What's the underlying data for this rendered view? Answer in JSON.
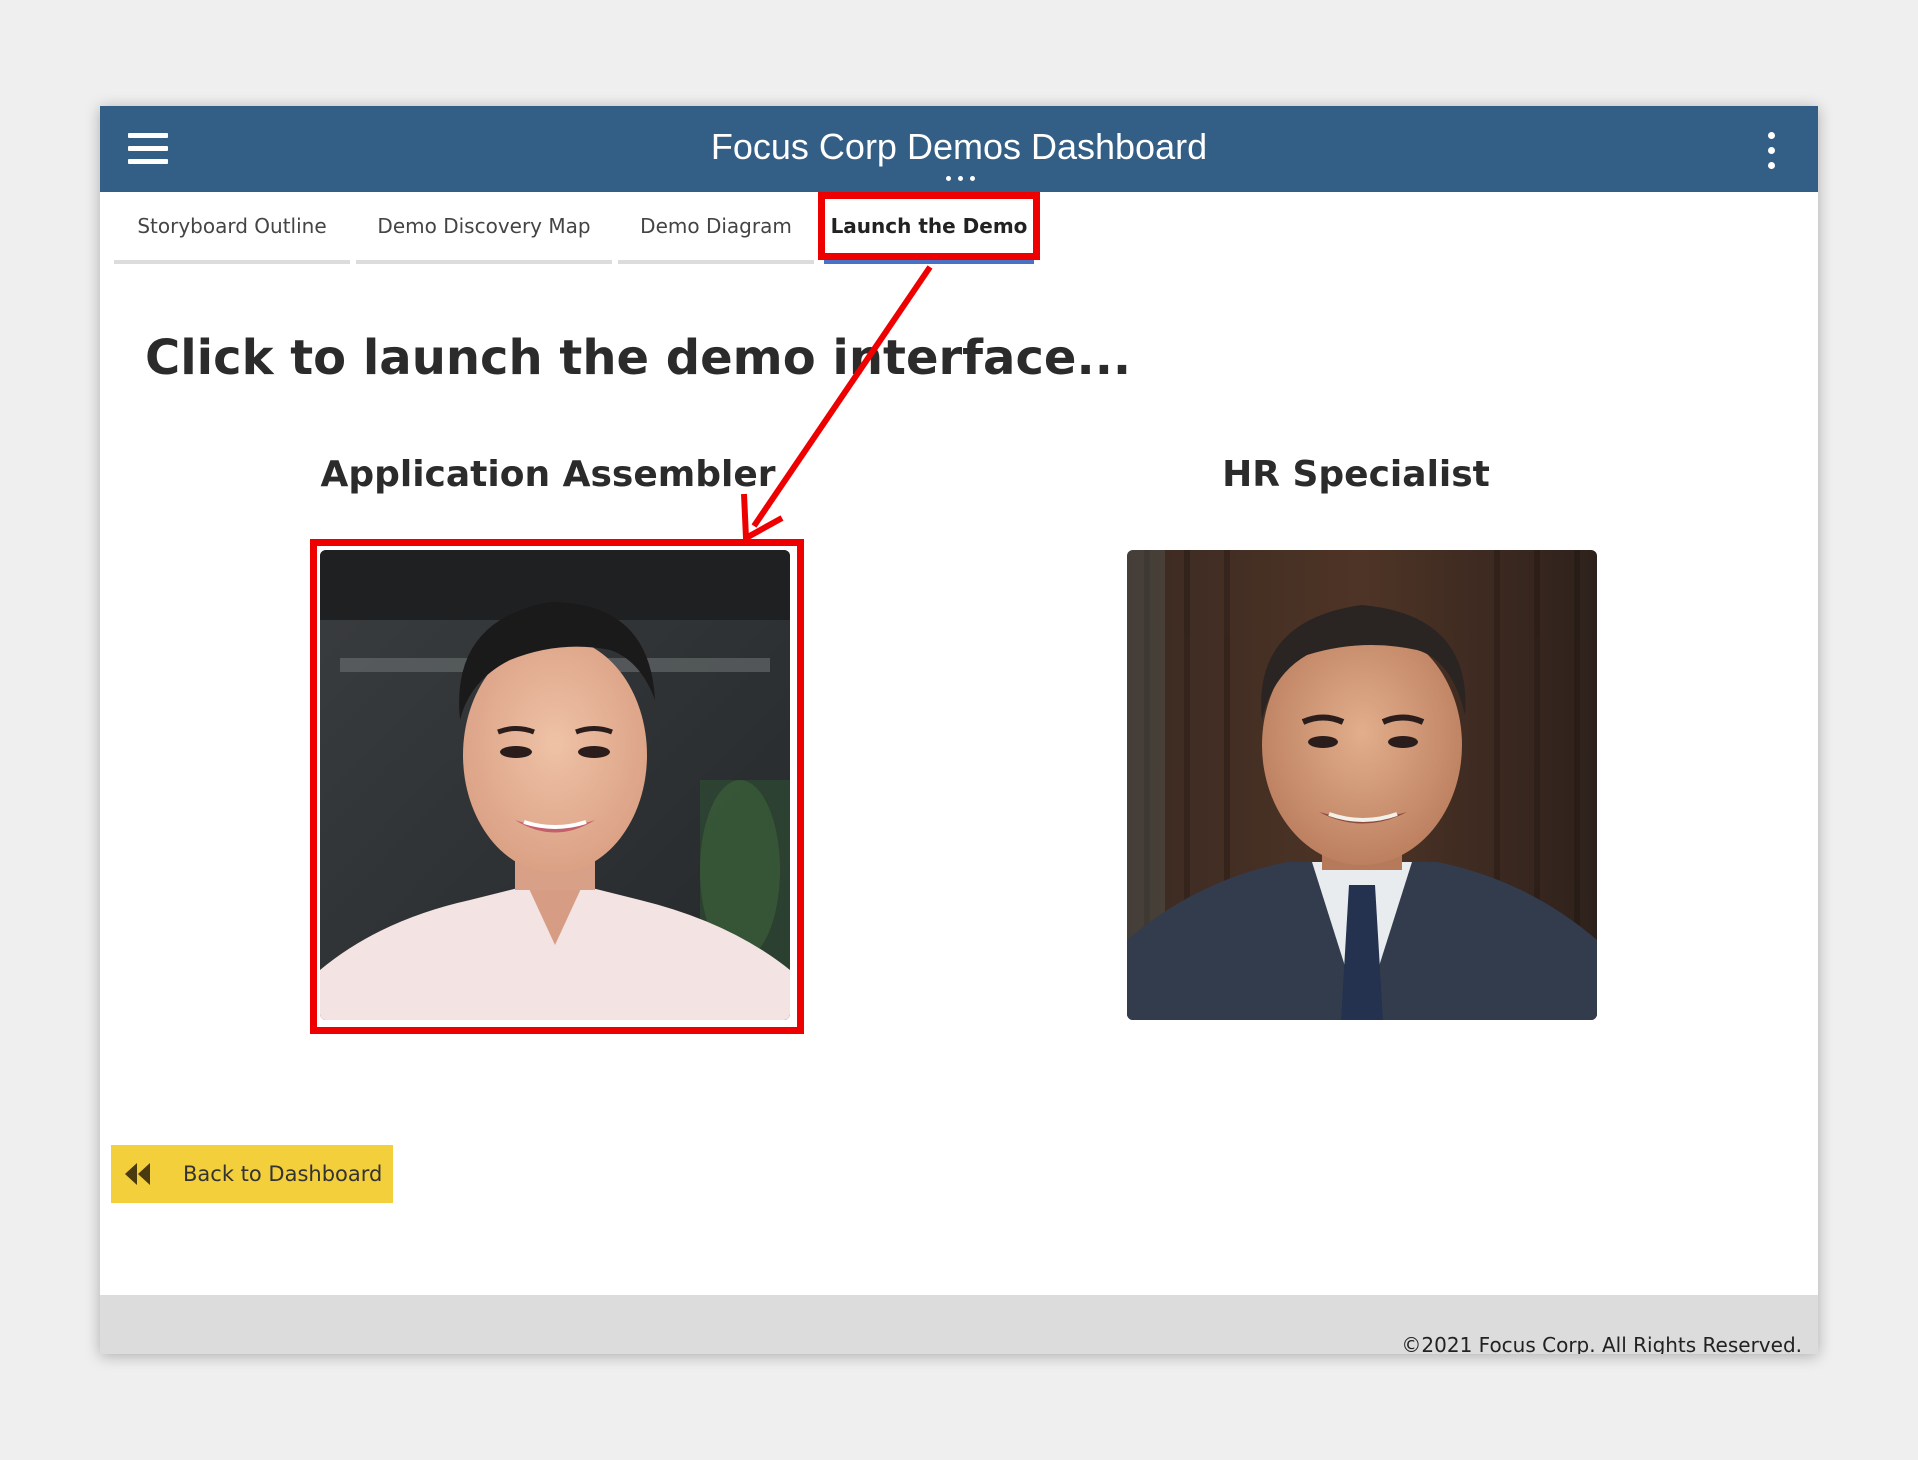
{
  "header": {
    "title": "Focus Corp Demos Dashboard",
    "menu_icon": "hamburger-menu-icon",
    "more_icon": "kebab-menu-icon"
  },
  "tabs": [
    {
      "label": "Storyboard Outline",
      "active": false
    },
    {
      "label": "Demo Discovery Map",
      "active": false
    },
    {
      "label": "Demo Diagram",
      "active": false
    },
    {
      "label": "Launch the Demo",
      "active": true
    }
  ],
  "main": {
    "heading": "Click to launch the demo interface...",
    "personas": [
      {
        "title": "Application Assembler",
        "image": "woman-portrait-photo"
      },
      {
        "title": "HR Specialist",
        "image": "man-portrait-photo"
      }
    ]
  },
  "back_button": {
    "label": "Back to Dashboard",
    "icon": "double-chevron-left-icon"
  },
  "footer": {
    "text": "©2021 Focus Corp. All Rights Reserved."
  },
  "colors": {
    "header_bg": "#335e85",
    "annotation_red": "#ee0000",
    "button_yellow": "#f4cf3c",
    "active_tab_underline": "#4a72c4"
  }
}
